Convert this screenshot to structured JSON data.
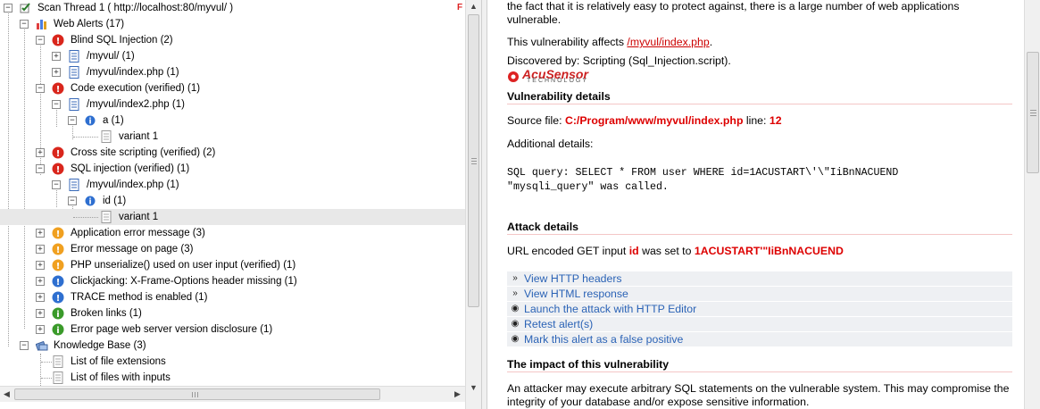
{
  "tree": {
    "scan_thread_label": "Scan Thread 1 ( http://localhost:80/myvul/ )",
    "web_alerts_label": "Web Alerts (17)",
    "items": [
      {
        "label": "Blind SQL Injection (2)"
      },
      {
        "label": "/myvul/ (1)"
      },
      {
        "label": "/myvul/index.php (1)"
      },
      {
        "label": "Code execution (verified) (1)"
      },
      {
        "label": "/myvul/index2.php (1)"
      },
      {
        "label": "a (1)"
      },
      {
        "label": "variant 1"
      },
      {
        "label": "Cross site scripting (verified) (2)"
      },
      {
        "label": "SQL injection (verified) (1)"
      },
      {
        "label": "/myvul/index.php (1)"
      },
      {
        "label": "id (1)"
      },
      {
        "label": "variant 1"
      },
      {
        "label": "Application error message (3)"
      },
      {
        "label": "Error message on page (3)"
      },
      {
        "label": "PHP unserialize() used on user input (verified) (1)"
      },
      {
        "label": "Clickjacking: X-Frame-Options header missing (1)"
      },
      {
        "label": "TRACE method is enabled (1)"
      },
      {
        "label": "Broken links (1)"
      },
      {
        "label": "Error page web server version disclosure (1)"
      },
      {
        "label": "Knowledge Base (3)"
      },
      {
        "label": "List of file extensions"
      },
      {
        "label": "List of files with inputs"
      }
    ],
    "f_marker": "F"
  },
  "details": {
    "intro_line1": "the fact that it is relatively easy to protect against, there is a large number of web applications",
    "intro_line2": "vulnerable.",
    "affects_prefix": "This vulnerability affects ",
    "affects_link": "/myvul/index.php",
    "affects_suffix": ".",
    "discovered_by": "Discovered by: Scripting (Sql_Injection.script).",
    "logo_text": "AcuSensor",
    "logo_sub": "TECHNOLOGY",
    "vuln_details_title": "Vulnerability details",
    "source_prefix": "Source file: ",
    "source_file": "C:/Program/www/myvul/index.php",
    "source_line_label": " line: ",
    "source_line": "12",
    "additional_details": "Additional details:",
    "sql_line1": "SQL query: SELECT * FROM user WHERE id=1ACUSTART\\'\\\"IiBnNACUEND",
    "sql_line2": "\"mysqli_query\" was called.",
    "attack_title": "Attack details",
    "attack_prefix": "URL encoded GET input ",
    "attack_param": "id",
    "attack_mid": " was set to ",
    "attack_value": "1ACUSTART'\"IiBnNACUEND",
    "actions": [
      {
        "icon": "double-chevron-icon",
        "label": "View HTTP headers"
      },
      {
        "icon": "double-chevron-icon",
        "label": "View HTML response"
      },
      {
        "icon": "bullet-icon",
        "label": "Launch the attack with HTTP Editor"
      },
      {
        "icon": "bullet-icon",
        "label": "Retest alert(s)"
      },
      {
        "icon": "bullet-icon",
        "label": "Mark this alert as a false positive"
      }
    ],
    "impact_title": "The impact of this vulnerability",
    "impact_line1": "An attacker may execute arbitrary SQL statements on the vulnerable system. This may compromise the",
    "impact_line2": "integrity of your database and/or expose sensitive information."
  },
  "colors": {
    "high_alert": "#d9261c",
    "medium_alert": "#f0a020",
    "low_alert": "#2e6fd0",
    "info_alert": "#3a9a2a",
    "link_red": "#cc0000",
    "action_blue": "#2b63b6"
  }
}
